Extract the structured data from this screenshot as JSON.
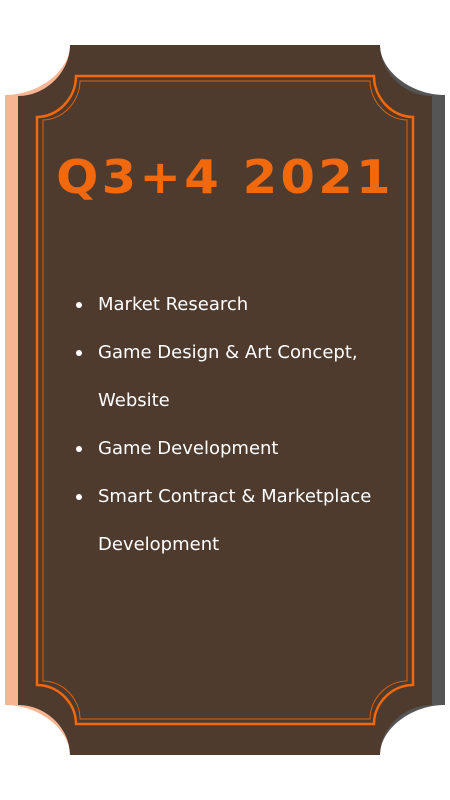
{
  "card": {
    "title": "Q3+4 2021",
    "colors": {
      "panel": "#4f3a2e",
      "accent": "#f2690d",
      "text": "#ffffff",
      "left_tab": "#f8b593",
      "right_tab": "#555555"
    }
  },
  "roadmap": {
    "items": [
      {
        "label": "Market Research"
      },
      {
        "label": "Game Design & Art Concept, Website"
      },
      {
        "label": "Game Development"
      },
      {
        "label": "Smart Contract & Marketplace Development"
      }
    ]
  }
}
